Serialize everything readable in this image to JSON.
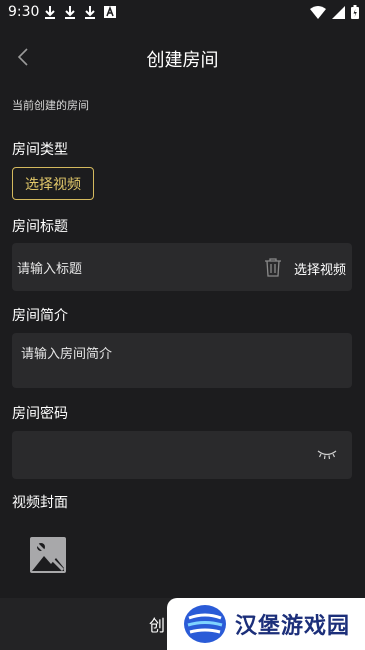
{
  "status_bar": {
    "time": "9:30",
    "icons": [
      "download-icon",
      "download-icon",
      "download-icon",
      "app-a-icon",
      "wifi-icon",
      "signal-icon",
      "battery-icon"
    ]
  },
  "nav": {
    "title": "创建房间"
  },
  "sub_caption": "当前创建的房间",
  "room_type": {
    "label": "房间类型",
    "button": "选择视频"
  },
  "room_title": {
    "label": "房间标题",
    "placeholder": "请输入标题",
    "select_label": "选择视频"
  },
  "room_intro": {
    "label": "房间简介",
    "placeholder": "请输入房间简介"
  },
  "room_password": {
    "label": "房间密码",
    "value": ""
  },
  "video_cover": {
    "label": "视频封面"
  },
  "bottom": {
    "create_label": "创"
  },
  "watermark": {
    "text": "汉堡游戏园"
  },
  "colors": {
    "background": "#1c1c1e",
    "field": "#2a2a2c",
    "accent": "#d4b95e"
  }
}
